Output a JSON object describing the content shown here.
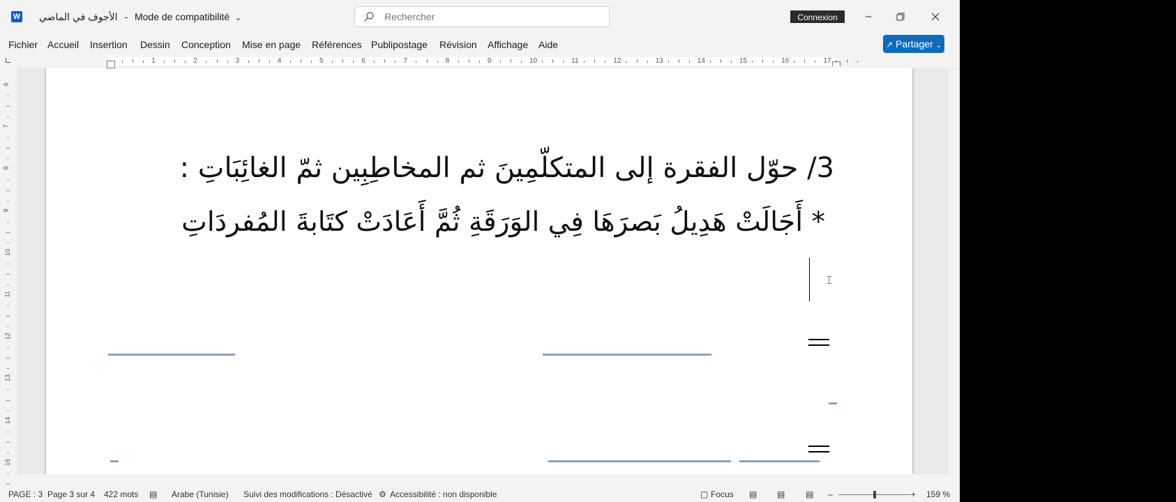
{
  "titlebar": {
    "app_icon": "word-icon",
    "doc_name": "الأجوف في الماضي",
    "separator": "-",
    "mode": "Mode de compatibilité",
    "search_placeholder": "Rechercher",
    "signin_label": "Connexion"
  },
  "menu": {
    "items": [
      "Fichier",
      "Accueil",
      "Insertion",
      "Dessin",
      "Conception",
      "Mise en page",
      "Références",
      "Publipostage",
      "Révision",
      "Affichage",
      "Aide"
    ],
    "share_label": "Partager"
  },
  "ruler": {
    "h_numbers": [
      "1",
      "2",
      "3",
      "4",
      "5",
      "6",
      "7",
      "8",
      "9",
      "10",
      "11",
      "12",
      "13",
      "14",
      "15",
      "16",
      "17"
    ],
    "v_numbers": [
      "6",
      "7",
      "8",
      "9",
      "10",
      "11",
      "12",
      "13",
      "14",
      "15"
    ]
  },
  "document": {
    "line1": "3/ حوّل الفقرة إلى المتكلّمِينَ ثم المخاطِبِين ثمّ الغائِبَاتِ :",
    "line2": "* أَجَالَتْ هَدِيلُ بَصرَهَا فِي  الوَرَقَةِ ثُمَّ أَعَادَتْ كتَابةَ المُفردَاتِ"
  },
  "status": {
    "page": "PAGE : 3",
    "page_of": "Page 3 sur 4",
    "words": "422 mots",
    "language": "Arabe (Tunisie)",
    "track_changes": "Suivi des modifications : Désactivé",
    "accessibility": "Accessibilité : non disponible",
    "focus": "Focus",
    "zoom": "159 %",
    "zoom_level_fraction": 0.5
  }
}
